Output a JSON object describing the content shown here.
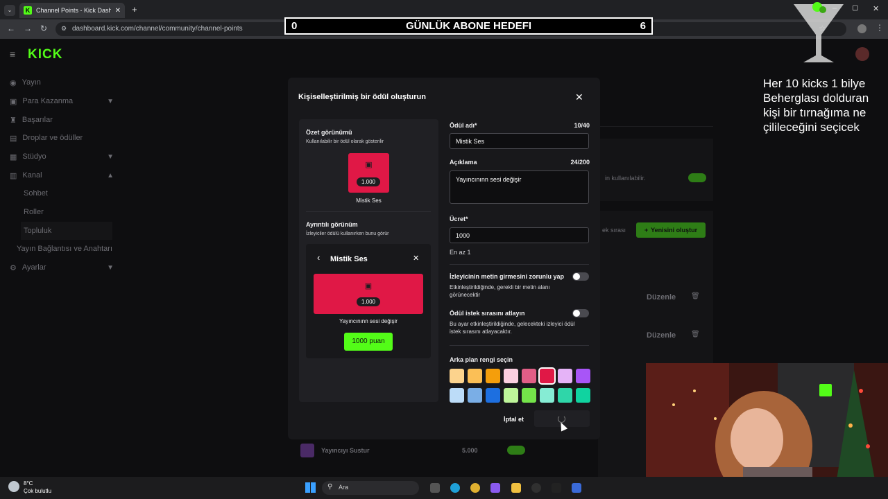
{
  "browser": {
    "tab_title": "Channel Points - Kick Dashboard",
    "url": "dashboard.kick.com/channel/community/channel-points"
  },
  "overlay": {
    "goal_left": "0",
    "goal_title": "GÜNLÜK ABONE HEDEFI",
    "goal_right": "6",
    "text": "Her 10 kicks 1 bilye Beherglası dolduran kişi bir tırnağıma ne çilileceğini seçicek"
  },
  "sidebar": {
    "logo": "KICK",
    "items": [
      {
        "label": "Yayın",
        "icon": "broadcast-icon"
      },
      {
        "label": "Para Kazanma",
        "icon": "money-icon"
      },
      {
        "label": "Başarılar",
        "icon": "trophy-icon"
      },
      {
        "label": "Droplar ve ödüller",
        "icon": "gift-icon"
      },
      {
        "label": "Stüdyo",
        "icon": "studio-icon"
      },
      {
        "label": "Kanal",
        "icon": "channel-icon"
      },
      {
        "label": "Sohbet"
      },
      {
        "label": "Roller"
      },
      {
        "label": "Topluluk"
      },
      {
        "label": "Yayın Bağlantısı ve Anahtarı"
      },
      {
        "label": "Ayarlar",
        "icon": "settings-icon"
      }
    ]
  },
  "background": {
    "available_text": "in kullanılabilir.",
    "queue_text": "ek sırası",
    "new_button": "Yenisini oluştur",
    "edit_label": "Düzenle",
    "row_name": "Yayıncıyı Sustur",
    "row_cost": "5.000"
  },
  "modal": {
    "title": "Kişiselleştirilmiş bir ödül oluşturun",
    "summary_title": "Özet görünümü",
    "summary_sub": "Kullanılabilir bir ödül olarak gösterilir",
    "cost_badge": "1.000",
    "reward_name": "Mistik Ses",
    "detail_title": "Ayrıntılı görünüm",
    "detail_sub": "İzleyiciler ödülü kullanırken bunu görür",
    "detail_desc": "Yayıncınınn sesi değişir",
    "points_button": "1000 puan",
    "name_label": "Ödül adı*",
    "name_count": "10/40",
    "name_value": "Mistik Ses",
    "desc_label": "Açıklama",
    "desc_count": "24/200",
    "desc_value": "Yayıncınınn sesi değişir",
    "cost_label": "Ücret*",
    "cost_value": "1000",
    "cost_hint": "En az 1",
    "toggle1_label": "İzleyicinin metin girmesini zorunlu yap",
    "toggle1_desc": "Etkinleştirildiğinde, gerekli bir metin alanı görünecektir",
    "toggle2_label": "Ödül istek sırasını atlayın",
    "toggle2_desc": "Bu ayar etkinleştirildiğinde, gelecekteki izleyici ödül istek sırasını atlayacaktır.",
    "color_label": "Arka plan rengi seçin",
    "colors": [
      "#fcd38d",
      "#fbbf56",
      "#f59e0b",
      "#fbcfe0",
      "#e15e86",
      "#e01846",
      "#e5b3f7",
      "#a855f7",
      "#bcdcf8",
      "#7aaee6",
      "#1d6fe0",
      "#bef59a",
      "#74e34a",
      "#86ecd4",
      "#2fd6a9",
      "#10d3a0"
    ],
    "selected_color": "#e01846",
    "cancel_label": "İptal et"
  },
  "taskbar": {
    "temp": "8°C",
    "weather": "Çok bulutlu",
    "search_placeholder": "Ara"
  }
}
